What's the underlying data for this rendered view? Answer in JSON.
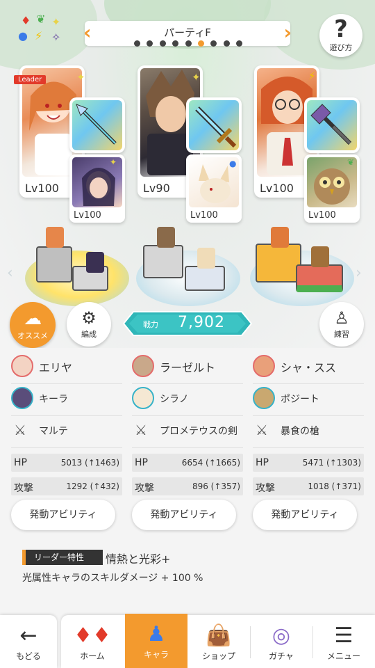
{
  "header": {
    "party_title": "パーティF",
    "party_page_count": 9,
    "party_page_active": 6,
    "help_label": "遊び方"
  },
  "party": [
    {
      "leader_tag": "Leader",
      "level": "Lv100",
      "element": "light",
      "sub_level": "Lv100",
      "sub_element": "light",
      "weapon_icon": "spear-icon"
    },
    {
      "level": "Lv90",
      "element": "light",
      "sub_level": "Lv100",
      "sub_element": "water",
      "weapon_icon": "sword-icon"
    },
    {
      "level": "Lv100",
      "element": "thunder",
      "sub_level": "Lv100",
      "sub_element": "wind",
      "weapon_icon": "lance-icon"
    }
  ],
  "buttons": {
    "recommend_label": "オススメ",
    "organize_label": "編成",
    "practice_label": "練習"
  },
  "power": {
    "label": "戦力",
    "value": "7,902"
  },
  "columns": [
    {
      "main_name": "エリヤ",
      "sub_name": "キーラ",
      "weapon_name": "マルテ",
      "hp_label": "HP",
      "hp_value": "5013 (↑1463)",
      "atk_label": "攻撃",
      "atk_value": "1292 (↑432)",
      "ability_label": "発動アビリティ"
    },
    {
      "main_name": "ラーゼルト",
      "sub_name": "シラノ",
      "weapon_name": "プロメテウスの剣",
      "hp_label": "HP",
      "hp_value": "6654 (↑1665)",
      "atk_label": "攻撃",
      "atk_value": "896 (↑357)",
      "ability_label": "発動アビリティ"
    },
    {
      "main_name": "シャ・スス",
      "sub_name": "ポジート",
      "weapon_name": "暴食の槍",
      "hp_label": "HP",
      "hp_value": "5471 (↑1303)",
      "atk_label": "攻撃",
      "atk_value": "1018 (↑371)",
      "ability_label": "発動アビリティ"
    }
  ],
  "leader_trait": {
    "tag": "リーダー特性",
    "name": "情熱と光彩+",
    "description": "光属性キャラのスキルダメージ + 100 %"
  },
  "nav": {
    "back_label": "もどる",
    "items": [
      "ホーム",
      "キャラ",
      "ショップ",
      "ガチャ",
      "メニュー"
    ],
    "active_index": 1
  },
  "colors": {
    "accent": "#f39a2e",
    "power_bg": "#3cc4c4",
    "leader": "#e23a2a"
  }
}
